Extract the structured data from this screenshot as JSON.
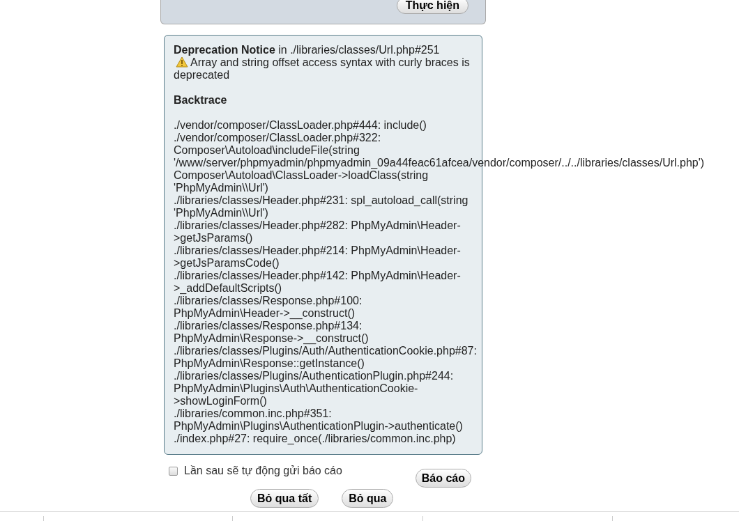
{
  "top_panel": {
    "button": "Thực hiện"
  },
  "notice": {
    "title": "**Deprecation Notice** in ./libraries/classes/Url.php#251",
    "message": "Array and string offset access syntax with curly braces is deprecated",
    "backtrace_heading": "Backtrace",
    "backtrace": [
      "./vendor/composer/ClassLoader.php#444: include()",
      "./vendor/composer/ClassLoader.php#322: Composer\\Autoload\\includeFile(string '/www/server/phpmyadmin/phpmyadmin_09a44feac61afcea/vendor/composer/../../libraries/classes/Url.php')",
      "Composer\\Autoload\\ClassLoader->loadClass(string 'PhpMyAdmin\\\\Url')",
      "./libraries/classes/Header.php#231: spl_autoload_call(string 'PhpMyAdmin\\\\Url')",
      "./libraries/classes/Header.php#282: PhpMyAdmin\\Header->getJsParams()",
      "./libraries/classes/Header.php#214: PhpMyAdmin\\Header->getJsParamsCode()",
      "./libraries/classes/Header.php#142: PhpMyAdmin\\Header->_addDefaultScripts()",
      "./libraries/classes/Response.php#100: PhpMyAdmin\\Header->__construct()",
      "./libraries/classes/Response.php#134: PhpMyAdmin\\Response->__construct()",
      "./libraries/classes/Plugins/Auth/AuthenticationCookie.php#87: PhpMyAdmin\\Response::getInstance()",
      "./libraries/classes/Plugins/AuthenticationPlugin.php#244: PhpMyAdmin\\Plugins\\Auth\\AuthenticationCookie->showLoginForm()",
      "./libraries/common.inc.php#351: PhpMyAdmin\\Plugins\\AuthenticationPlugin->authenticate()",
      "./index.php#27: require_once(./libraries/common.inc.php)"
    ]
  },
  "auto_report": {
    "label": "Lần sau sẽ tự động gửi báo cáo",
    "checked": false
  },
  "report_button": "Báo cáo",
  "buttons": [
    "Bỏ qua tất",
    "Bỏ qua"
  ]
}
